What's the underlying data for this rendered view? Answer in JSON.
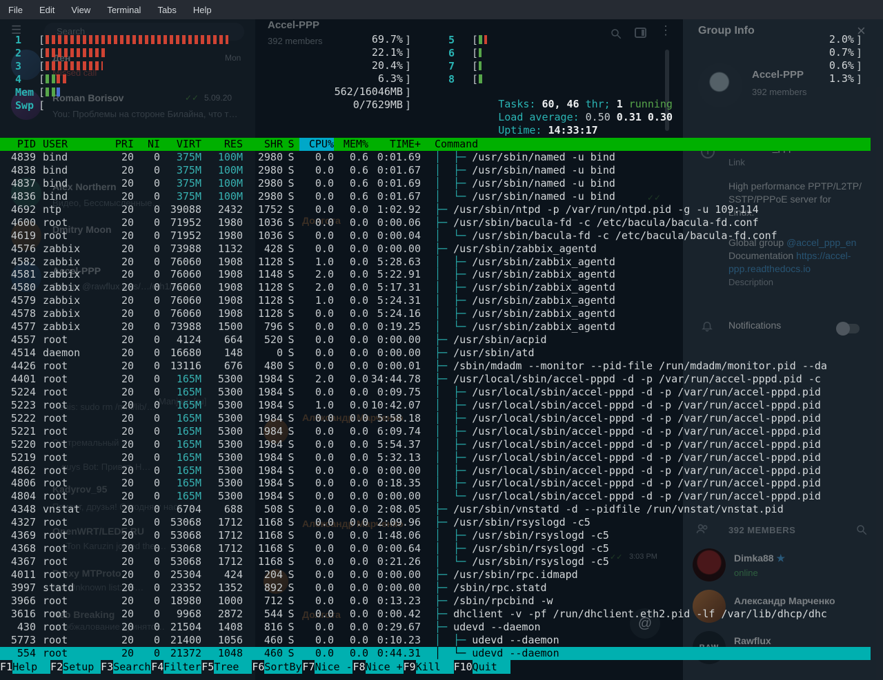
{
  "menu_bar": {
    "items": [
      "File",
      "Edit",
      "View",
      "Terminal",
      "Tabs",
      "Help"
    ]
  },
  "telegram": {
    "search_placeholder": "Search",
    "icons": {
      "hamburger": "☰",
      "kebab": "⋮",
      "close": "×",
      "checks": "✓✓",
      "star": "★",
      "at": "@",
      "info": "i"
    },
    "chat_header": {
      "title": "Accel-PPP",
      "subtitle": "392 members"
    },
    "sidebar": [
      "Ден",
      "Missed call",
      "Mon",
      "Roman Borisov",
      "5.09.20",
      "You: Проблемы на стороне Билайна, что т…",
      "Alex Northern",
      "Видео, Бессмысленные…",
      "Dmitry Moon",
      "Accel-PPP",
      "Захар: @rawflux /sys/…/eth1/st…",
      "Denis: sudo rm /mnt/lib/…",
      "Manjaro [ru]",
      "Экстремальный X",
      "…guys Bot: Привет, Н…",
      "Kadyrov_95",
      "Привет, друзья! Сегодня у нас…",
      "OpenWRT/LEDE RU",
      "Ton Karuzin joined the …",
      "Proxy MTProto",
      "Not Unknown list: 55…",
      "Neo Breaking",
      "та обжалование принято…"
    ],
    "chat_ghosts": [
      "Долгота",
      "Александр Марченко",
      "Александр Марченко",
      "3:03 PM",
      "Долгота"
    ],
    "group_info": {
      "title": "Group Info",
      "name": "Accel-PPP",
      "members": "392 members",
      "link_value": "t.me/accel_ppp",
      "link_label": "Link",
      "desc_lines": [
        "High performance PPTP/L2TP/",
        "SSTP/PPPoE server for",
        "Linux."
      ],
      "global_prefix": "Global group ",
      "global_link": "@accel_ppp_en",
      "doc_prefix": "Documentation ",
      "doc_link1": "https://accel-",
      "doc_link2": "ppp.readthedocs.io",
      "desc_label": "Description",
      "notifications_label": "Notifications",
      "members_header": "392 MEMBERS",
      "member_list": [
        {
          "name": "Dimka88",
          "status": "online",
          "avatar_text": ""
        },
        {
          "name": "Александр Марченко",
          "status": "",
          "avatar_text": ""
        },
        {
          "name": "Rawflux",
          "status": "",
          "avatar_text": "RAW"
        }
      ]
    }
  },
  "htop": {
    "meters_left": [
      {
        "label": "1",
        "value": "69.7%",
        "fills": [
          {
            "w": 51,
            "c": "#cf4333"
          }
        ]
      },
      {
        "label": "2",
        "value": "22.1%",
        "fills": [
          {
            "w": 17,
            "c": "#cf4333"
          }
        ]
      },
      {
        "label": "3",
        "value": "20.4%",
        "fills": [
          {
            "w": 16,
            "c": "#cf4333"
          }
        ]
      },
      {
        "label": "4",
        "value": "6.3%",
        "fills": [
          {
            "w": 3,
            "c": "#57a64a"
          },
          {
            "w": 3,
            "c": "#cf4333"
          }
        ]
      },
      {
        "label": "Mem",
        "value": "562/16046MB",
        "fills": [
          {
            "w": 3,
            "c": "#57a64a"
          },
          {
            "w": 1.2,
            "c": "#4a6fd0"
          }
        ]
      },
      {
        "label": "Swp",
        "value": "0/7629MB",
        "fills": []
      }
    ],
    "meters_right": [
      {
        "label": "5",
        "value": "2.0%",
        "fills": [
          {
            "w": 1.4,
            "c": "#57a64a"
          },
          {
            "w": 0.8,
            "c": "#cf4333"
          }
        ]
      },
      {
        "label": "6",
        "value": "0.7%",
        "fills": [
          {
            "w": 0.8,
            "c": "#57a64a"
          }
        ]
      },
      {
        "label": "7",
        "value": "0.6%",
        "fills": [
          {
            "w": 0.8,
            "c": "#57a64a"
          }
        ]
      },
      {
        "label": "8",
        "value": "1.3%",
        "fills": [
          {
            "w": 1.2,
            "c": "#57a64a"
          }
        ]
      }
    ],
    "tasks": {
      "label": "Tasks:",
      "count": "60,",
      "thr": "46",
      "thr_label": "thr;",
      "running": "1",
      "running_label": "running"
    },
    "load": {
      "label": "Load average:",
      "v1": "0.50",
      "v2": "0.31",
      "v3": "0.30"
    },
    "uptime": {
      "label": "Uptime:",
      "value": "14:33:17"
    },
    "columns": [
      "PID",
      "USER",
      "PRI",
      "NI",
      "VIRT",
      "RES",
      "SHR",
      "S",
      "CPU%",
      "MEM%",
      "TIME+",
      "Command"
    ],
    "sort_column": "CPU%",
    "processes": [
      [
        "4839",
        "bind",
        "20",
        "0",
        "375M",
        "100M",
        "2980",
        "S",
        "0.0",
        "0.6",
        "0:01.69",
        "│  ├─ ",
        "/usr/sbin/named -u bind",
        false
      ],
      [
        "4838",
        "bind",
        "20",
        "0",
        "375M",
        "100M",
        "2980",
        "S",
        "0.0",
        "0.6",
        "0:01.67",
        "│  ├─ ",
        "/usr/sbin/named -u bind",
        false
      ],
      [
        "4837",
        "bind",
        "20",
        "0",
        "375M",
        "100M",
        "2980",
        "S",
        "0.0",
        "0.6",
        "0:01.69",
        "│  ├─ ",
        "/usr/sbin/named -u bind",
        false
      ],
      [
        "4836",
        "bind",
        "20",
        "0",
        "375M",
        "100M",
        "2980",
        "S",
        "0.0",
        "0.6",
        "0:01.67",
        "│  └─ ",
        "/usr/sbin/named -u bind",
        false
      ],
      [
        "4692",
        "ntp",
        "20",
        "0",
        "39088",
        "2432",
        "1752",
        "S",
        "0.0",
        "0.0",
        "1:02.92",
        "├─ ",
        "/usr/sbin/ntpd -p /var/run/ntpd.pid -g -u 109:114",
        false
      ],
      [
        "4600",
        "root",
        "20",
        "0",
        "71952",
        "1980",
        "1036",
        "S",
        "0.0",
        "0.0",
        "0:00.06",
        "├─ ",
        "/usr/sbin/bacula-fd -c /etc/bacula/bacula-fd.conf",
        false
      ],
      [
        "4619",
        "root",
        "20",
        "0",
        "71952",
        "1980",
        "1036",
        "S",
        "0.0",
        "0.0",
        "0:00.04",
        "│  └─ ",
        "/usr/sbin/bacula-fd -c /etc/bacula/bacula-fd.conf",
        false
      ],
      [
        "4576",
        "zabbix",
        "20",
        "0",
        "73988",
        "1132",
        "428",
        "S",
        "0.0",
        "0.0",
        "0:00.00",
        "├─ ",
        "/usr/sbin/zabbix_agentd",
        false
      ],
      [
        "4582",
        "zabbix",
        "20",
        "0",
        "76060",
        "1908",
        "1128",
        "S",
        "1.0",
        "0.0",
        "5:28.63",
        "│  ├─ ",
        "/usr/sbin/zabbix_agentd",
        false
      ],
      [
        "4581",
        "zabbix",
        "20",
        "0",
        "76060",
        "1908",
        "1148",
        "S",
        "2.0",
        "0.0",
        "5:22.91",
        "│  ├─ ",
        "/usr/sbin/zabbix_agentd",
        false
      ],
      [
        "4580",
        "zabbix",
        "20",
        "0",
        "76060",
        "1908",
        "1128",
        "S",
        "2.0",
        "0.0",
        "5:17.31",
        "│  ├─ ",
        "/usr/sbin/zabbix_agentd",
        false
      ],
      [
        "4579",
        "zabbix",
        "20",
        "0",
        "76060",
        "1908",
        "1128",
        "S",
        "1.0",
        "0.0",
        "5:24.31",
        "│  ├─ ",
        "/usr/sbin/zabbix_agentd",
        false
      ],
      [
        "4578",
        "zabbix",
        "20",
        "0",
        "76060",
        "1908",
        "1128",
        "S",
        "0.0",
        "0.0",
        "5:24.16",
        "│  ├─ ",
        "/usr/sbin/zabbix_agentd",
        false
      ],
      [
        "4577",
        "zabbix",
        "20",
        "0",
        "73988",
        "1500",
        "796",
        "S",
        "0.0",
        "0.0",
        "0:19.25",
        "│  └─ ",
        "/usr/sbin/zabbix_agentd",
        false
      ],
      [
        "4557",
        "root",
        "20",
        "0",
        "4124",
        "664",
        "520",
        "S",
        "0.0",
        "0.0",
        "0:00.00",
        "├─ ",
        "/usr/sbin/acpid",
        false
      ],
      [
        "4514",
        "daemon",
        "20",
        "0",
        "16680",
        "148",
        "0",
        "S",
        "0.0",
        "0.0",
        "0:00.00",
        "├─ ",
        "/usr/sbin/atd",
        false
      ],
      [
        "4426",
        "root",
        "20",
        "0",
        "13116",
        "676",
        "480",
        "S",
        "0.0",
        "0.0",
        "0:00.01",
        "├─ ",
        "/sbin/mdadm --monitor --pid-file /run/mdadm/monitor.pid --da",
        false
      ],
      [
        "4401",
        "root",
        "20",
        "0",
        "165M",
        "5300",
        "1984",
        "S",
        "2.0",
        "0.0",
        "34:44.78",
        "├─ ",
        "/usr/local/sbin/accel-pppd -d -p /var/run/accel-pppd.pid -c",
        false
      ],
      [
        "5224",
        "root",
        "20",
        "0",
        "165M",
        "5300",
        "1984",
        "S",
        "0.0",
        "0.0",
        "0:09.75",
        "│  ├─ ",
        "/usr/local/sbin/accel-pppd -d -p /var/run/accel-pppd.pid",
        false
      ],
      [
        "5223",
        "root",
        "20",
        "0",
        "165M",
        "5300",
        "1984",
        "S",
        "1.0",
        "0.0",
        "10:42.07",
        "│  ├─ ",
        "/usr/local/sbin/accel-pppd -d -p /var/run/accel-pppd.pid",
        false
      ],
      [
        "5222",
        "root",
        "20",
        "0",
        "165M",
        "5300",
        "1984",
        "S",
        "0.0",
        "0.0",
        "5:58.18",
        "│  ├─ ",
        "/usr/local/sbin/accel-pppd -d -p /var/run/accel-pppd.pid",
        false
      ],
      [
        "5221",
        "root",
        "20",
        "0",
        "165M",
        "5300",
        "1984",
        "S",
        "0.0",
        "0.0",
        "6:09.74",
        "│  ├─ ",
        "/usr/local/sbin/accel-pppd -d -p /var/run/accel-pppd.pid",
        false
      ],
      [
        "5220",
        "root",
        "20",
        "0",
        "165M",
        "5300",
        "1984",
        "S",
        "0.0",
        "0.0",
        "5:54.37",
        "│  ├─ ",
        "/usr/local/sbin/accel-pppd -d -p /var/run/accel-pppd.pid",
        false
      ],
      [
        "5219",
        "root",
        "20",
        "0",
        "165M",
        "5300",
        "1984",
        "S",
        "0.0",
        "0.0",
        "5:32.13",
        "│  ├─ ",
        "/usr/local/sbin/accel-pppd -d -p /var/run/accel-pppd.pid",
        false
      ],
      [
        "4862",
        "root",
        "20",
        "0",
        "165M",
        "5300",
        "1984",
        "S",
        "0.0",
        "0.0",
        "0:00.00",
        "│  ├─ ",
        "/usr/local/sbin/accel-pppd -d -p /var/run/accel-pppd.pid",
        false
      ],
      [
        "4806",
        "root",
        "20",
        "0",
        "165M",
        "5300",
        "1984",
        "S",
        "0.0",
        "0.0",
        "0:18.35",
        "│  ├─ ",
        "/usr/local/sbin/accel-pppd -d -p /var/run/accel-pppd.pid",
        false
      ],
      [
        "4804",
        "root",
        "20",
        "0",
        "165M",
        "5300",
        "1984",
        "S",
        "0.0",
        "0.0",
        "0:00.00",
        "│  └─ ",
        "/usr/local/sbin/accel-pppd -d -p /var/run/accel-pppd.pid",
        false
      ],
      [
        "4348",
        "vnstat",
        "20",
        "0",
        "6704",
        "688",
        "508",
        "S",
        "0.0",
        "0.0",
        "2:08.05",
        "├─ ",
        "/usr/sbin/vnstatd -d --pidfile /run/vnstat/vnstat.pid",
        false
      ],
      [
        "4327",
        "root",
        "20",
        "0",
        "53068",
        "1712",
        "1168",
        "S",
        "0.0",
        "0.0",
        "2:09.96",
        "├─ ",
        "/usr/sbin/rsyslogd -c5",
        false
      ],
      [
        "4369",
        "root",
        "20",
        "0",
        "53068",
        "1712",
        "1168",
        "S",
        "0.0",
        "0.0",
        "1:48.06",
        "│  ├─ ",
        "/usr/sbin/rsyslogd -c5",
        false
      ],
      [
        "4368",
        "root",
        "20",
        "0",
        "53068",
        "1712",
        "1168",
        "S",
        "0.0",
        "0.0",
        "0:00.64",
        "│  ├─ ",
        "/usr/sbin/rsyslogd -c5",
        false
      ],
      [
        "4367",
        "root",
        "20",
        "0",
        "53068",
        "1712",
        "1168",
        "S",
        "0.0",
        "0.0",
        "0:21.26",
        "│  └─ ",
        "/usr/sbin/rsyslogd -c5",
        false
      ],
      [
        "4011",
        "root",
        "20",
        "0",
        "25304",
        "424",
        "204",
        "S",
        "0.0",
        "0.0",
        "0:00.00",
        "├─ ",
        "/usr/sbin/rpc.idmapd",
        false
      ],
      [
        "3997",
        "statd",
        "20",
        "0",
        "23352",
        "1352",
        "892",
        "S",
        "0.0",
        "0.0",
        "0:00.00",
        "├─ ",
        "/sbin/rpc.statd",
        false
      ],
      [
        "3966",
        "root",
        "20",
        "0",
        "18980",
        "1000",
        "712",
        "S",
        "0.0",
        "0.0",
        "0:13.23",
        "├─ ",
        "/sbin/rpcbind -w",
        false
      ],
      [
        "3616",
        "root",
        "20",
        "0",
        "9968",
        "2872",
        "544",
        "S",
        "0.0",
        "0.0",
        "0:00.42",
        "├─ ",
        "dhclient -v -pf /run/dhclient.eth2.pid -lf /var/lib/dhcp/dhc",
        false
      ],
      [
        "430",
        "root",
        "20",
        "0",
        "21504",
        "1408",
        "816",
        "S",
        "0.0",
        "0.0",
        "0:29.67",
        "├─ ",
        "udevd --daemon",
        false
      ],
      [
        "5773",
        "root",
        "20",
        "0",
        "21400",
        "1056",
        "460",
        "S",
        "0.0",
        "0.0",
        "0:10.23",
        "│  ├─ ",
        "udevd --daemon",
        false
      ],
      [
        "554",
        "root",
        "20",
        "0",
        "21372",
        "1048",
        "460",
        "S",
        "0.0",
        "0.0",
        "0:44.31",
        "│  └─ ",
        "udevd --daemon",
        true
      ]
    ],
    "fkeys": [
      [
        "F1",
        "Help"
      ],
      [
        "F2",
        "Setup"
      ],
      [
        "F3",
        "Search"
      ],
      [
        "F4",
        "Filter"
      ],
      [
        "F5",
        "Tree"
      ],
      [
        "F6",
        "SortBy"
      ],
      [
        "F7",
        "Nice -"
      ],
      [
        "F8",
        "Nice +"
      ],
      [
        "F9",
        "Kill"
      ],
      [
        "F10",
        "Quit"
      ]
    ]
  }
}
